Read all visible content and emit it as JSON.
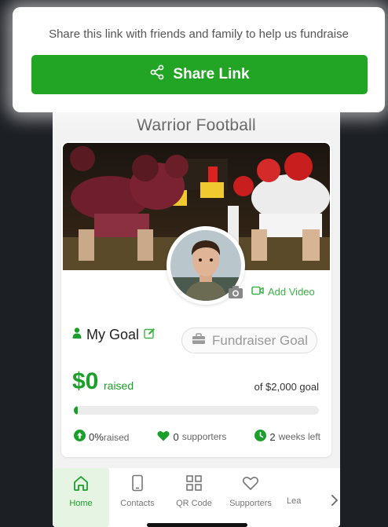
{
  "popup": {
    "message": "Share this link with friends and family  to help us fundraise",
    "button_label": "Share Link"
  },
  "fundraiser": {
    "team_name": "Warrior Football",
    "add_video_label": "Add Video",
    "my_goal_label": "My Goal",
    "fundraiser_goal_label": "Fundraiser Goal",
    "raised_amount": "$0",
    "raised_word": "raised",
    "goal_text": "of $2,000 goal",
    "progress_fraction": 0.01,
    "stats": {
      "percent_value": "0%",
      "percent_label": "raised",
      "supporters_value": "0",
      "supporters_label": "supporters",
      "time_value": "2",
      "time_label": "weeks left"
    }
  },
  "nav": {
    "items": [
      {
        "label": "Home",
        "icon": "home-icon",
        "active": true
      },
      {
        "label": "Contacts",
        "icon": "phone-icon",
        "active": false
      },
      {
        "label": "QR Code",
        "icon": "qr-code-icon",
        "active": false
      },
      {
        "label": "Supporters",
        "icon": "heart-icon",
        "active": false
      },
      {
        "label": "Lea",
        "icon": "trophy-icon",
        "active": false
      }
    ]
  },
  "colors": {
    "brand_green": "#22a524",
    "text_green": "#1a9f2a",
    "background": "#1c1f24"
  }
}
